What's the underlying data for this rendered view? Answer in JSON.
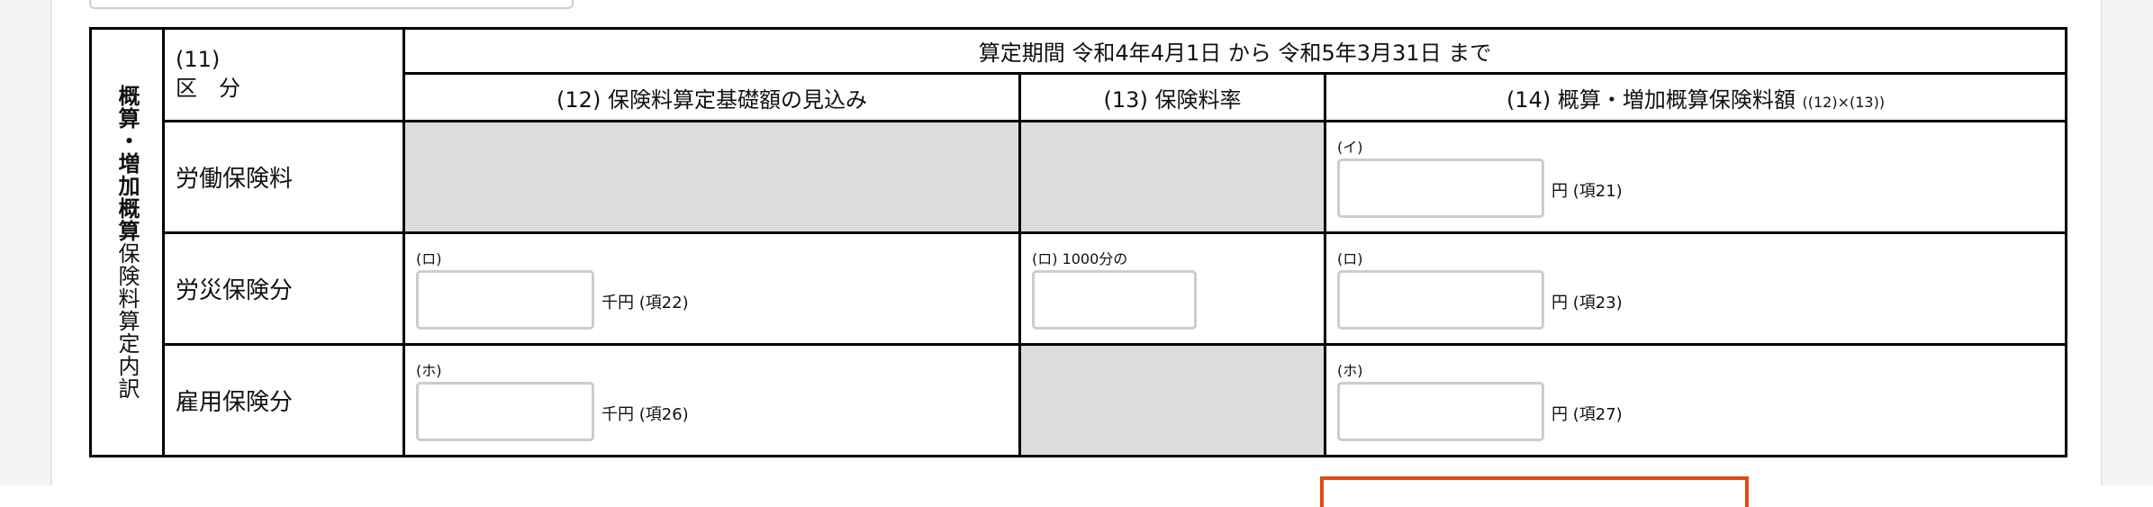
{
  "side_title": {
    "bold": "概算・増加概算",
    "normal": "保険料算定内訳"
  },
  "header": {
    "category_num": "(11)",
    "category_label": "区　分",
    "period": "算定期間 令和4年4月1日 から 令和5年3月31日 まで",
    "col12": "(12) 保険料算定基礎額の見込み",
    "col13": "(13) 保険料率",
    "col14": "(14) 概算・増加概算保険料額",
    "col14_note": "((12)×(13))"
  },
  "rows": [
    {
      "label": "労働保険料",
      "c14_label": "(イ)",
      "c14_unit": "円 (項21)",
      "c14_value": ""
    },
    {
      "label": "労災保険分",
      "c12_label": "(ロ)",
      "c12_unit": "千円 (項22)",
      "c12_value": "",
      "c13_label": "(ロ) 1000分の",
      "c13_value": "",
      "c14_label": "(ロ)",
      "c14_unit": "円 (項23)",
      "c14_value": ""
    },
    {
      "label": "雇用保険分",
      "c12_label": "(ホ)",
      "c12_unit": "千円 (項26)",
      "c12_value": "",
      "c14_label": "(ホ)",
      "c14_unit": "円 (項27)",
      "c14_value": ""
    }
  ]
}
